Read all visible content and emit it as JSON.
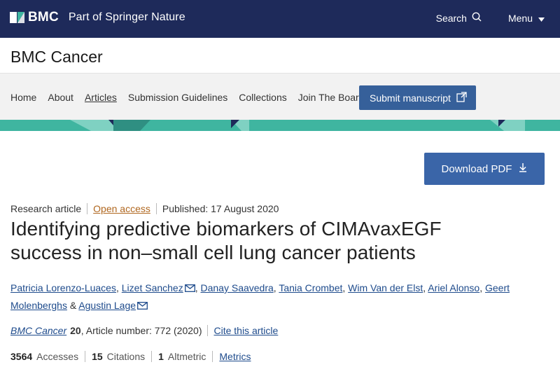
{
  "header": {
    "logo_text": "BMC",
    "subtitle": "Part of Springer Nature",
    "search_label": "Search",
    "menu_label": "Menu",
    "background_color": "#1e2a5a"
  },
  "journal": {
    "title": "BMC Cancer"
  },
  "nav": {
    "items": [
      {
        "label": "Home"
      },
      {
        "label": "About"
      },
      {
        "label": "Articles"
      },
      {
        "label": "Submission Guidelines"
      },
      {
        "label": "Collections"
      },
      {
        "label": "Join The Board"
      }
    ],
    "submit_label": "Submit manuscript"
  },
  "actions": {
    "download_label": "Download PDF"
  },
  "article": {
    "type": "Research article",
    "access": "Open access",
    "published": "Published: 17 August 2020",
    "title": "Identifying predictive biomarkers of CIMAvaxEGF success in non–small cell lung cancer patients",
    "authors": [
      "Patricia Lorenzo-Luaces",
      "Lizet Sanchez",
      "Danay Saavedra",
      "Tania Crombet",
      "Wim Van der Elst",
      "Ariel Alonso",
      "Geert Molenberghs",
      "Agustin Lage"
    ],
    "separators": {
      "comma": ",",
      "ampersand": "&"
    },
    "citation": {
      "journal": "BMC Cancer",
      "volume": "20",
      "article_number": ", Article number: 772 (2020)",
      "cite_label": "Cite this article"
    },
    "metrics": {
      "accesses_count": "3564",
      "accesses_label": "Accesses",
      "citations_count": "15",
      "citations_label": "Citations",
      "altmetric_count": "1",
      "altmetric_label": "Altmetric",
      "metrics_link": "Metrics"
    }
  },
  "colors": {
    "accent_teal": "#3fb5a0",
    "button_blue": "#3a65a8",
    "link_blue": "#1e4b8c",
    "open_access": "#b0671f"
  }
}
